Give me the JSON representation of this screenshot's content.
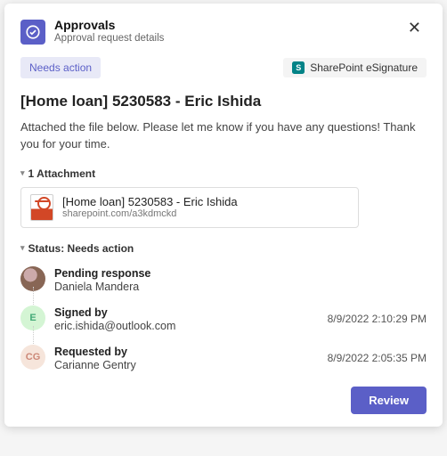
{
  "header": {
    "title": "Approvals",
    "subtitle": "Approval request details"
  },
  "status_badge": "Needs action",
  "source": {
    "label": "SharePoint eSignature"
  },
  "subject": "[Home loan] 5230583 - Eric Ishida",
  "message": "Attached the file below. Please let me know if you have any questions! Thank you for your time.",
  "attachments": {
    "heading": "1 Attachment",
    "item": {
      "name": "[Home loan] 5230583 - Eric Ishida",
      "location": "sharepoint.com/a3kdmckd"
    }
  },
  "status_section": {
    "heading": "Status: Needs action"
  },
  "timeline": {
    "pending": {
      "title": "Pending response",
      "name": "Daniela Mandera"
    },
    "signed": {
      "title": "Signed by",
      "email": "eric.ishida@outlook.com",
      "time": "8/9/2022 2:10:29 PM",
      "initial": "E"
    },
    "requested": {
      "title": "Requested by",
      "name": "Carianne Gentry",
      "time": "8/9/2022 2:05:35 PM",
      "initial": "CG"
    }
  },
  "actions": {
    "review": "Review"
  }
}
